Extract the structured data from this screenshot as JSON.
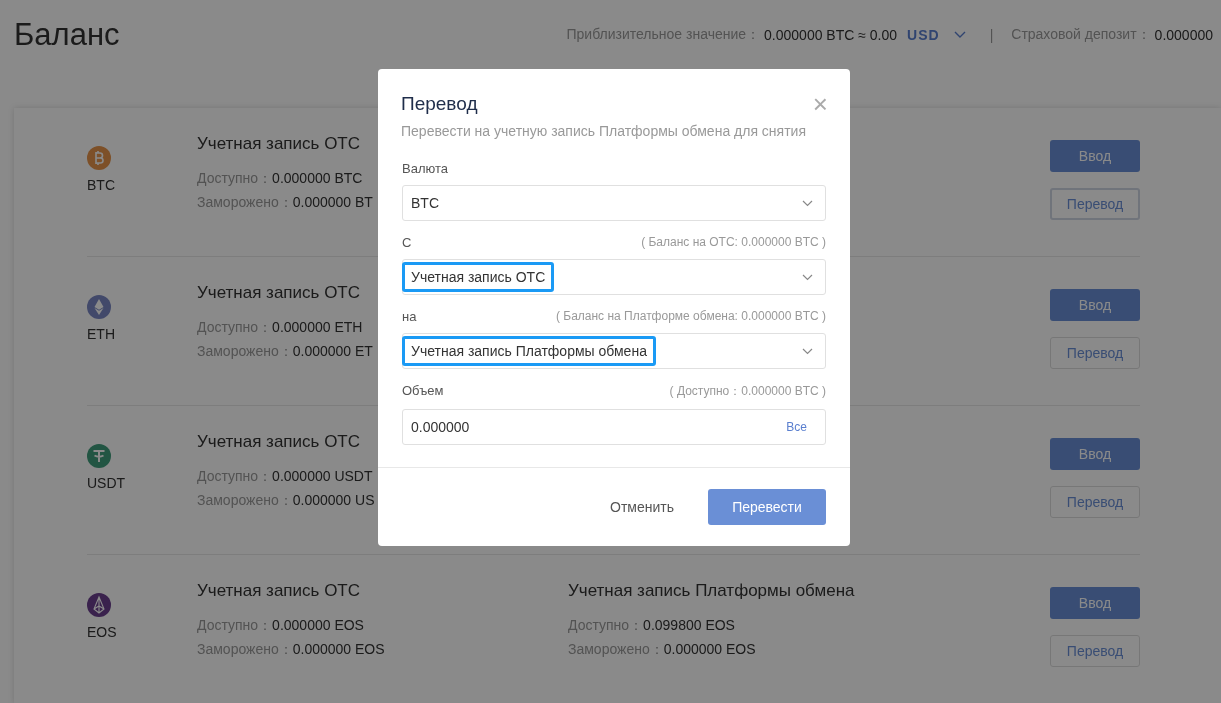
{
  "page": {
    "title": "Баланс"
  },
  "summary": {
    "approx_label": "Приблизительное значение：",
    "approx_value": "0.000000 BTC ≈ 0.00",
    "currency": "USD",
    "separator": "|",
    "deposit_label": "Страховой депозит：",
    "deposit_value": "0.000000"
  },
  "coins": [
    {
      "symbol": "BTC",
      "otc": {
        "title": "Учетная запись OTC",
        "available_label": "Доступно：",
        "available": "0.000000 BTC",
        "frozen_label": "Заморожено：",
        "frozen": "0.000000 BT"
      },
      "deposit_button": "Ввод",
      "transfer_button": {
        "label": "Перевод",
        "focused": true
      }
    },
    {
      "symbol": "ETH",
      "otc": {
        "title": "Учетная запись OTC",
        "available_label": "Доступно：",
        "available": "0.000000 ETH",
        "frozen_label": "Заморожено：",
        "frozen": "0.000000 ET"
      },
      "deposit_button": "Ввод",
      "transfer_button": {
        "label": "Перевод",
        "focused": false
      }
    },
    {
      "symbol": "USDT",
      "otc": {
        "title": "Учетная запись OTC",
        "available_label": "Доступно：",
        "available": "0.000000 USDT",
        "frozen_label": "Заморожено：",
        "frozen": "0.000000 US"
      },
      "deposit_button": "Ввод",
      "transfer_button": {
        "label": "Перевод",
        "focused": false
      }
    },
    {
      "symbol": "EOS",
      "otc": {
        "title": "Учетная запись OTC",
        "available_label": "Доступно：",
        "available": "0.000000 EOS",
        "frozen_label": "Заморожено：",
        "frozen": "0.000000 EOS"
      },
      "exchange": {
        "title": "Учетная запись Платформы обмена",
        "available_label": "Доступно：",
        "available": "0.099800 EOS",
        "frozen_label": "Заморожено：",
        "frozen": "0.000000 EOS"
      },
      "deposit_button": "Ввод",
      "transfer_button": {
        "label": "Перевод",
        "focused": false
      }
    }
  ],
  "dialog": {
    "title": "Перевод",
    "close": "×",
    "subtitle": "Перевести на учетную запись Платформы обмена для снятия",
    "fields": [
      {
        "kind": "select",
        "label": "Валюта",
        "value": "BTC"
      },
      {
        "kind": "select",
        "label": "С",
        "hint": "( Баланс на OTC: 0.000000 BTC )",
        "value": "Учетная запись OTC",
        "highlighted": true
      },
      {
        "kind": "select",
        "label": "на",
        "hint": "( Баланс на Платформе обмена: 0.000000 BTC )",
        "value": "Учетная запись Платформы обмена",
        "highlighted": true
      },
      {
        "kind": "amount",
        "label": "Объем",
        "hint": "( Доступно：0.000000 BTC )",
        "value": "0.000000",
        "action": "Все"
      }
    ],
    "cancel": "Отменить",
    "submit": "Перевести"
  }
}
